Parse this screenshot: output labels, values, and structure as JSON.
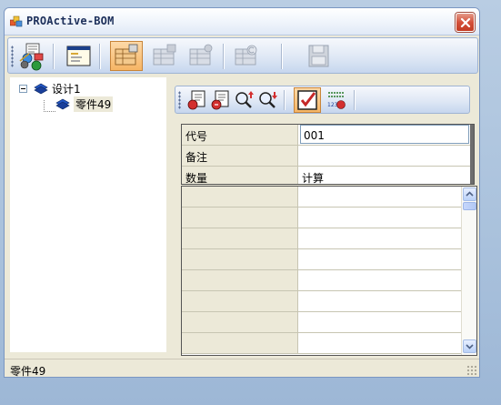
{
  "window": {
    "title": "PROActive-BOM",
    "close_icon": "close-icon",
    "accent": "#e0e9f6"
  },
  "toolbar": {
    "buttons": [
      {
        "name": "parts-manager-icon",
        "state": "normal"
      },
      {
        "name": "form-window-icon",
        "state": "normal"
      },
      {
        "name": "bom-view-icon",
        "state": "active"
      },
      {
        "name": "bom-edit-icon",
        "state": "disabled"
      },
      {
        "name": "bom-settings-icon",
        "state": "disabled"
      },
      {
        "name": "bom-copy-icon",
        "state": "disabled"
      },
      {
        "name": "save-icon",
        "state": "disabled"
      }
    ]
  },
  "tree": {
    "root_label": "设计1",
    "child_label": "零件49"
  },
  "sub_toolbar": {
    "buttons": [
      {
        "name": "import-icon"
      },
      {
        "name": "export-icon"
      },
      {
        "name": "search-up-icon"
      },
      {
        "name": "search-down-icon"
      },
      {
        "name": "checkbox-checked-icon",
        "state": "active"
      },
      {
        "name": "numbering-icon"
      }
    ]
  },
  "properties": [
    {
      "key": "代号",
      "value": "001"
    },
    {
      "key": "备注",
      "value": ""
    },
    {
      "key": "数量",
      "value": "计算"
    }
  ],
  "grid": {
    "rows": [
      {
        "c1": "",
        "c2": ""
      },
      {
        "c1": "",
        "c2": ""
      },
      {
        "c1": "",
        "c2": ""
      },
      {
        "c1": "",
        "c2": ""
      },
      {
        "c1": "",
        "c2": ""
      },
      {
        "c1": "",
        "c2": ""
      },
      {
        "c1": "",
        "c2": ""
      },
      {
        "c1": "",
        "c2": ""
      }
    ]
  },
  "status": {
    "text": "零件49"
  }
}
